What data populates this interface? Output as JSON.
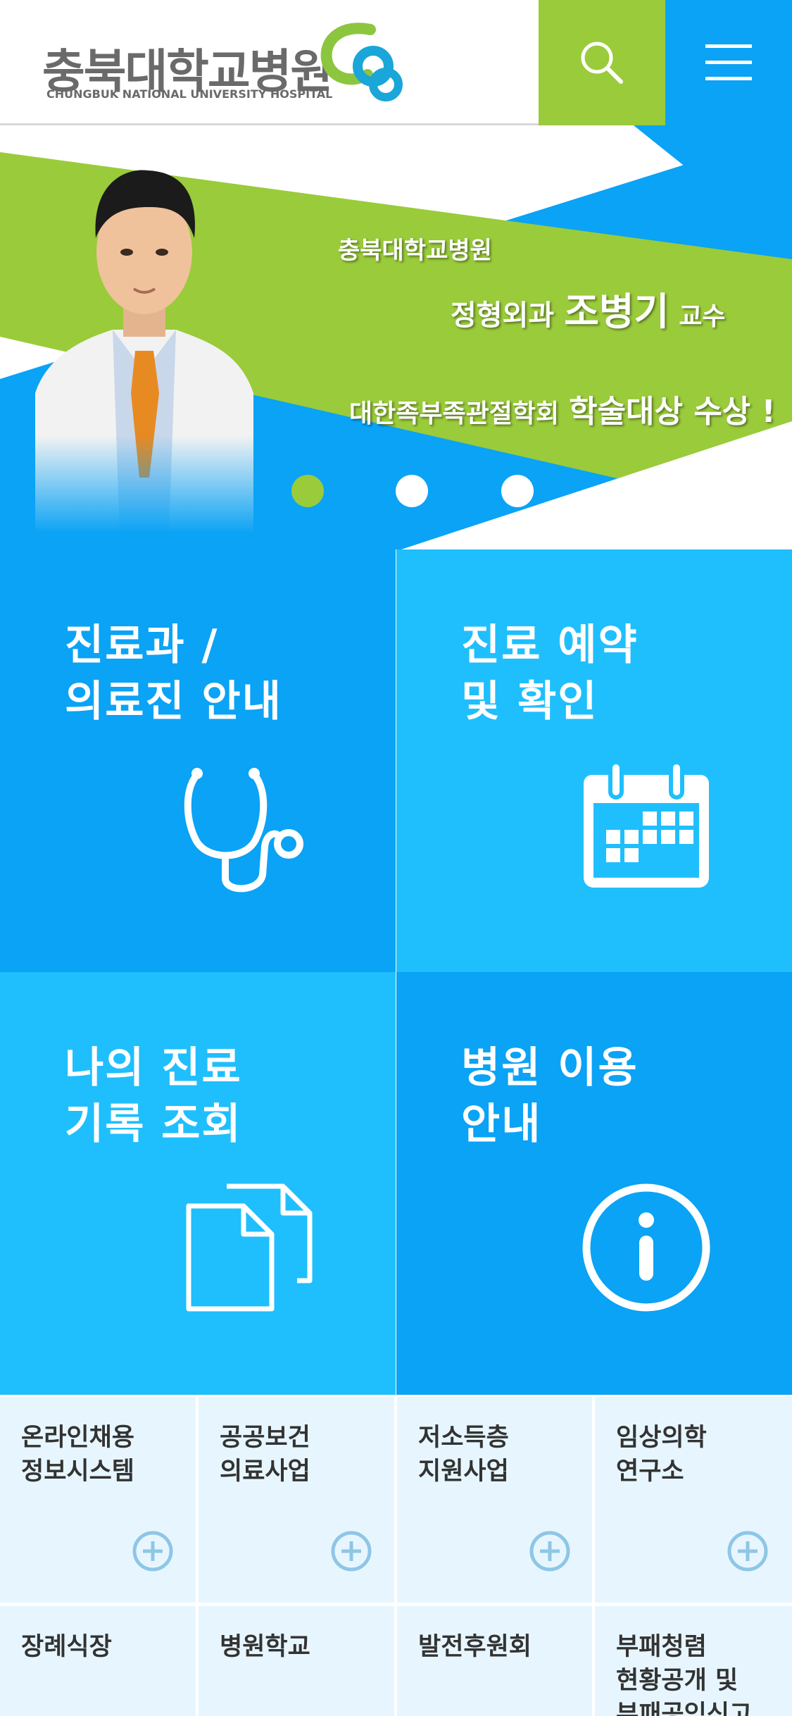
{
  "header": {
    "logo_text": "충북대학교병원",
    "logo_subtext": "CHUNGBUK NATIONAL UNIVERSITY HOSPITAL",
    "logo_icon": "cbnuh-logo-mark",
    "search_icon": "search-icon",
    "menu_icon": "hamburger-menu-icon",
    "colors": {
      "search_bg": "#9acb3a",
      "menu_bg": "#0aa3f5"
    }
  },
  "banner": {
    "line1": "충북대학교병원",
    "dept": "정형외과",
    "name": "조병기",
    "title": "교수",
    "award_org": "대한족부족관절학회",
    "award": "학술대상 수상 !",
    "slides": 3,
    "active_slide": 1,
    "colors": {
      "green": "#9acb3a",
      "blue": "#0aa3f5"
    }
  },
  "tiles": [
    {
      "label": "진료과 /\n의료진 안내",
      "icon": "stethoscope-icon",
      "color": "#0aa3f5"
    },
    {
      "label": "진료 예약\n및 확인",
      "icon": "calendar-icon",
      "color": "#1fbffd"
    },
    {
      "label": "나의 진료\n기록 조회",
      "icon": "documents-icon",
      "color": "#1fbffd"
    },
    {
      "label": "병원 이용\n안내",
      "icon": "info-icon",
      "color": "#0aa3f5"
    }
  ],
  "quick_links": [
    {
      "label": "온라인채용\n정보시스템",
      "icon": "plus-circle-icon"
    },
    {
      "label": "공공보건\n의료사업",
      "icon": "plus-circle-icon"
    },
    {
      "label": "저소득층\n지원사업",
      "icon": "plus-circle-icon"
    },
    {
      "label": "임상의학\n연구소",
      "icon": "plus-circle-icon"
    },
    {
      "label": "장례식장"
    },
    {
      "label": "병원학교"
    },
    {
      "label": "발전후원회"
    },
    {
      "label": "부패청렴\n현황공개 및\n부패공익신고"
    }
  ]
}
